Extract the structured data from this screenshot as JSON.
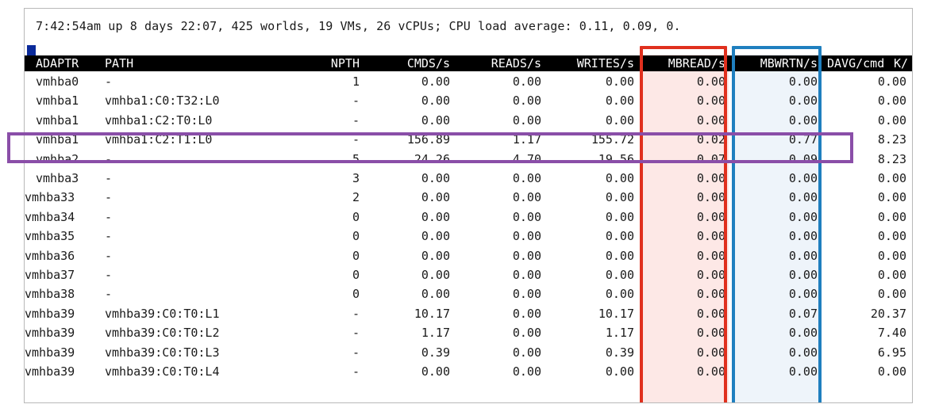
{
  "status_line": "7:42:54am up 8 days 22:07, 425 worlds, 19 VMs, 26 vCPUs; CPU load average: 0.11, 0.09, 0.",
  "columns": [
    "ADAPTR",
    "PATH",
    "NPTH",
    "CMDS/s",
    "READS/s",
    "WRITES/s",
    "MBREAD/s",
    "MBWRTN/s",
    "DAVG/cmd",
    "K/"
  ],
  "rows": [
    [
      "vmhba0",
      "-",
      "1",
      "0.00",
      "0.00",
      "0.00",
      "0.00",
      "0.00",
      "0.00"
    ],
    [
      "vmhba1",
      "vmhba1:C0:T32:L0",
      "-",
      "0.00",
      "0.00",
      "0.00",
      "0.00",
      "0.00",
      "0.00"
    ],
    [
      "vmhba1",
      "vmhba1:C2:T0:L0",
      "-",
      "0.00",
      "0.00",
      "0.00",
      "0.00",
      "0.00",
      "0.00"
    ],
    [
      "vmhba1",
      "vmhba1:C2:T1:L0",
      "-",
      "156.89",
      "1.17",
      "155.72",
      "0.02",
      "0.77",
      "8.23"
    ],
    [
      "vmhba2",
      "-",
      "5",
      "24.26",
      "4.70",
      "19.56",
      "0.07",
      "0.09",
      "8.23"
    ],
    [
      "vmhba3",
      "-",
      "3",
      "0.00",
      "0.00",
      "0.00",
      "0.00",
      "0.00",
      "0.00"
    ],
    [
      "vmhba33",
      "-",
      "2",
      "0.00",
      "0.00",
      "0.00",
      "0.00",
      "0.00",
      "0.00"
    ],
    [
      "vmhba34",
      "-",
      "0",
      "0.00",
      "0.00",
      "0.00",
      "0.00",
      "0.00",
      "0.00"
    ],
    [
      "vmhba35",
      "-",
      "0",
      "0.00",
      "0.00",
      "0.00",
      "0.00",
      "0.00",
      "0.00"
    ],
    [
      "vmhba36",
      "-",
      "0",
      "0.00",
      "0.00",
      "0.00",
      "0.00",
      "0.00",
      "0.00"
    ],
    [
      "vmhba37",
      "-",
      "0",
      "0.00",
      "0.00",
      "0.00",
      "0.00",
      "0.00",
      "0.00"
    ],
    [
      "vmhba38",
      "-",
      "0",
      "0.00",
      "0.00",
      "0.00",
      "0.00",
      "0.00",
      "0.00"
    ],
    [
      "vmhba39",
      "vmhba39:C0:T0:L1",
      "-",
      "10.17",
      "0.00",
      "10.17",
      "0.00",
      "0.07",
      "20.37"
    ],
    [
      "vmhba39",
      "vmhba39:C0:T0:L2",
      "-",
      "1.17",
      "0.00",
      "1.17",
      "0.00",
      "0.00",
      "7.40"
    ],
    [
      "vmhba39",
      "vmhba39:C0:T0:L3",
      "-",
      "0.39",
      "0.00",
      "0.39",
      "0.00",
      "0.00",
      "6.95"
    ],
    [
      "vmhba39",
      "vmhba39:C0:T0:L4",
      "-",
      "0.00",
      "0.00",
      "0.00",
      "0.00",
      "0.00",
      "0.00"
    ]
  ],
  "highlights": {
    "mbread_column_color": "#e0301e",
    "mbwrtn_column_color": "#1f7fbf",
    "selected_row_color": "#8a4ea8"
  }
}
